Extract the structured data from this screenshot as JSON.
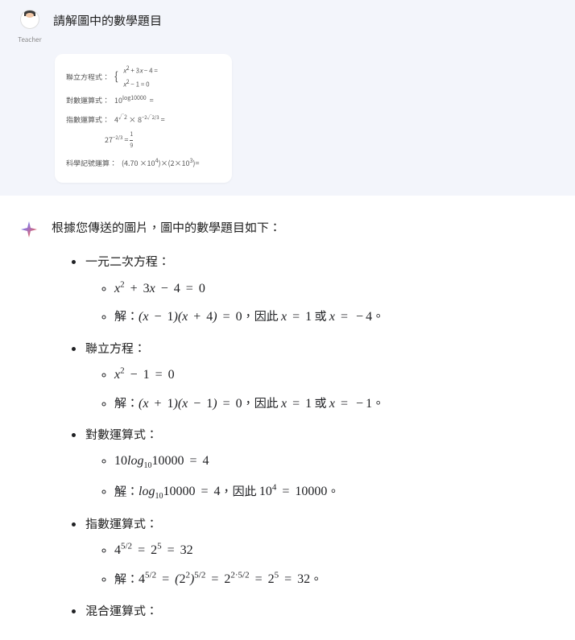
{
  "user": {
    "label": "Teacher",
    "prompt": "請解圖中的數學題目"
  },
  "attachment": {
    "line1_label": "聯立方程式：",
    "line1_eq1": "x² + 3x − 4 =",
    "line1_eq2": "x² − 1 = 0",
    "line2_label": "對數運算式：",
    "line2_eq": "10^log10000  =",
    "line3_label": "指數運算式：",
    "line3_eq": "4^√2 × 8^(−2√2/3) =",
    "line3b_eq": "27^(−2/3) = 1/9",
    "line4_label": "科學記號運算：",
    "line4_eq": "(4.70 ×10⁴)×(2×10³)="
  },
  "response": {
    "intro": "根據您傳送的圖片，圖中的數學題目如下：",
    "items": [
      {
        "heading": "一元二次方程：",
        "sub": [
          {
            "html": "x<sup>2</sup> + 3x − 4 = 0"
          },
          {
            "html": "解：(x − 1)(x + 4) = 0，因此 x = 1 或 x = −4。"
          }
        ]
      },
      {
        "heading": "聯立方程：",
        "sub": [
          {
            "html": "x<sup>2</sup> − 1 = 0"
          },
          {
            "html": "解：(x + 1)(x − 1) = 0，因此 x = 1 或 x = −1。"
          }
        ]
      },
      {
        "heading": "對數運算式：",
        "sub": [
          {
            "html": "10log<sub>10</sub>10000 = 4"
          },
          {
            "html": "解：log<sub>10</sub>10000 = 4，因此 10<sup>4</sup> = 10000。"
          }
        ]
      },
      {
        "heading": "指數運算式：",
        "sub": [
          {
            "html": "4<sup>5/2</sup> = 2<sup>5</sup> = 32"
          },
          {
            "html": "解：4<sup>5/2</sup> = (2<sup>2</sup>)<sup>5/2</sup> = 2<sup>2·5/2</sup> = 2<sup>5</sup> = 32。"
          }
        ]
      },
      {
        "heading": "混合運算式：",
        "sub": []
      }
    ]
  }
}
